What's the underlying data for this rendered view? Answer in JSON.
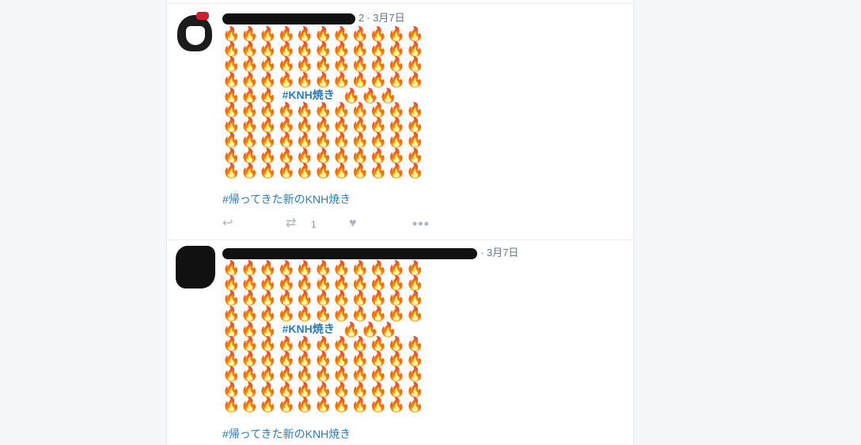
{
  "tweets": [
    {
      "name_suffix": "2",
      "separator": "·",
      "date": "3月7日",
      "fire_rows": [
        "🔥🔥🔥🔥🔥🔥🔥🔥🔥🔥🔥",
        "🔥🔥🔥🔥🔥🔥🔥🔥🔥🔥🔥",
        "🔥🔥🔥🔥🔥🔥🔥🔥🔥🔥🔥",
        "🔥🔥🔥🔥🔥🔥🔥🔥🔥🔥🔥",
        "🔥🔥🔥🔥🔥🔥🔥🔥🔥🔥🔥",
        "🔥🔥🔥🔥🔥🔥🔥🔥🔥🔥🔥",
        "🔥🔥🔥🔥🔥🔥🔥🔥🔥🔥🔥",
        "🔥🔥🔥🔥🔥🔥🔥🔥🔥🔥🔥",
        "🔥🔥🔥🔥🔥🔥🔥🔥🔥🔥🔥"
      ],
      "mid_left": "🔥🔥🔥",
      "mid_hashtag": "#KNH焼き",
      "mid_right": "🔥🔥🔥",
      "hashtag": "#帰ってきた新のKNH焼き",
      "actions": {
        "reply_icon": "↩",
        "retweet_icon": "⇄",
        "retweet_count": "1",
        "like_icon": "♥",
        "more_icon": "•••"
      }
    },
    {
      "name_suffix": "",
      "separator": "·",
      "date": "3月7日",
      "fire_rows": [
        "🔥🔥🔥🔥🔥🔥🔥🔥🔥🔥🔥",
        "🔥🔥🔥🔥🔥🔥🔥🔥🔥🔥🔥",
        "🔥🔥🔥🔥🔥🔥🔥🔥🔥🔥🔥",
        "🔥🔥🔥🔥🔥🔥🔥🔥🔥🔥🔥",
        "🔥🔥🔥🔥🔥🔥🔥🔥🔥🔥🔥",
        "🔥🔥🔥🔥🔥🔥🔥🔥🔥🔥🔥",
        "🔥🔥🔥🔥🔥🔥🔥🔥🔥🔥🔥",
        "🔥🔥🔥🔥🔥🔥🔥🔥🔥🔥🔥",
        "🔥🔥🔥🔥🔥🔥🔥🔥🔥🔥🔥"
      ],
      "mid_left": "🔥🔥🔥",
      "mid_hashtag": "#KNH焼き",
      "mid_right": "🔥🔥🔥",
      "hashtag": "#帰ってきた新のKNH焼き"
    }
  ]
}
